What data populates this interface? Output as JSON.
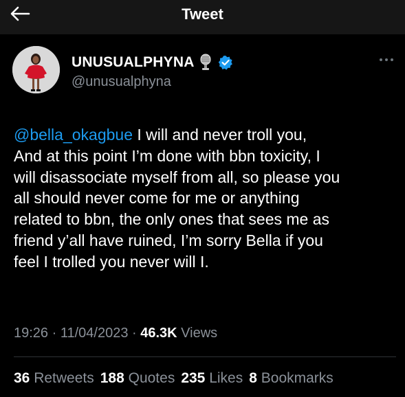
{
  "header": {
    "title": "Tweet",
    "back_icon": "arrow-left-icon"
  },
  "author": {
    "display_name": "UNUSUALPHYNA",
    "handle": "@unusualphyna",
    "badge_icons": [
      "microphone-icon",
      "verified-badge-icon"
    ]
  },
  "tweet": {
    "mention": "@bella_okagbue",
    "text": " I will and never troll you,\nAnd at this point I’m done with bbn toxicity, I\nwill disassociate myself from all, so please you\nall should never come for me or anything\nrelated to bbn, the only ones that sees me as\nfriend y’all have ruined, I’m sorry Bella if you\nfeel I trolled you never will I."
  },
  "meta": {
    "time": "19:26",
    "separator": " · ",
    "date": "11/04/2023",
    "views_count": "46.3K",
    "views_label": " Views"
  },
  "stats": {
    "retweets_count": "36",
    "retweets_label": " Retweets",
    "quotes_count": "188",
    "quotes_label": " Quotes",
    "likes_count": "235",
    "likes_label": " Likes",
    "bookmarks_count": "8",
    "bookmarks_label": " Bookmarks"
  },
  "colors": {
    "background": "#000000",
    "header_bg": "#161616",
    "text": "#ffffff",
    "secondary_text": "#8b9199",
    "link": "#1d9bf0",
    "divider": "#2f3336"
  }
}
